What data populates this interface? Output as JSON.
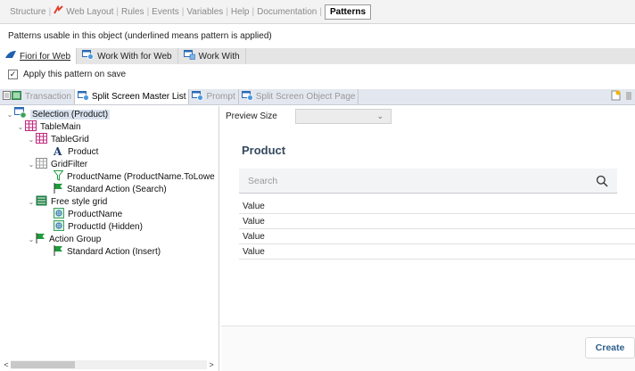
{
  "top_tabs": [
    {
      "label": "Structure"
    },
    {
      "label": "Web Layout"
    },
    {
      "label": "Rules"
    },
    {
      "label": "Events"
    },
    {
      "label": "Variables"
    },
    {
      "label": "Help"
    },
    {
      "label": "Documentation"
    },
    {
      "label": "Patterns",
      "active": true
    }
  ],
  "description": "Patterns usable in this object (underlined means pattern is applied)",
  "pattern_tabs": [
    {
      "label": "Fiori for Web",
      "active": true
    },
    {
      "label": "Work With for Web"
    },
    {
      "label": "Work With"
    }
  ],
  "apply_pattern": {
    "label": "Apply this pattern on save",
    "checked": true,
    "check_mark": "✓"
  },
  "sub_tabs": [
    {
      "label": "Transaction"
    },
    {
      "label": "Split Screen Master List",
      "active": true
    },
    {
      "label": "Prompt"
    },
    {
      "label": "Split Screen Object Page"
    }
  ],
  "tree": [
    {
      "label": "Selection (Product)",
      "selected": true,
      "toggle": "⌄"
    },
    {
      "label": "TableMain",
      "toggle": "⌄"
    },
    {
      "label": "TableGrid",
      "toggle": "⌄"
    },
    {
      "label": "Product",
      "glyph": "A"
    },
    {
      "label": "GridFilter",
      "toggle": "⌄"
    },
    {
      "label": "ProductName (ProductName.ToLowe"
    },
    {
      "label": "Standard Action (Search)"
    },
    {
      "label": "Free style grid",
      "toggle": "⌄"
    },
    {
      "label": "ProductName"
    },
    {
      "label": "ProductId (Hidden)"
    },
    {
      "label": "Action Group",
      "toggle": "⌄"
    },
    {
      "label": "Standard Action (Insert)"
    }
  ],
  "scroll": {
    "left": "<",
    "right": ">"
  },
  "preview": {
    "size_label": "Preview Size",
    "size_caret": "⌄",
    "title": "Product",
    "search_placeholder": "Search",
    "rows": [
      "Value",
      "Value",
      "Value",
      "Value"
    ],
    "create_label": "Create"
  },
  "colors": {
    "accent_blue": "#2c5f8a",
    "title_color": "#34495e",
    "selection_bg": "#d9e3f0",
    "action_green": "#1e9b3c",
    "grid_magenta": "#c0287f"
  }
}
